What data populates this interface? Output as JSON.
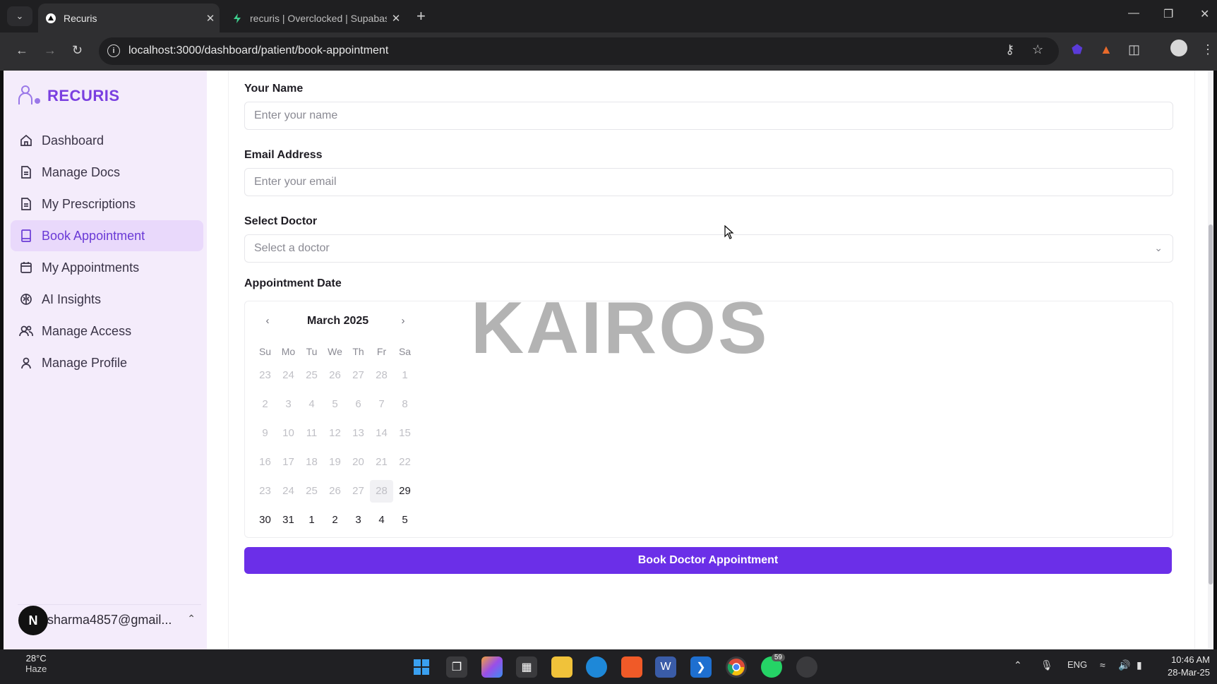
{
  "browser": {
    "tabs": [
      {
        "title": "Recuris",
        "active": true
      },
      {
        "title": "recuris | Overclocked | Supabas",
        "active": false
      }
    ],
    "url": "localhost:3000/dashboard/patient/book-appointment"
  },
  "sidebar": {
    "brand": "RECURIS",
    "items": [
      {
        "label": "Dashboard",
        "icon": "home-icon"
      },
      {
        "label": "Manage Docs",
        "icon": "document-icon"
      },
      {
        "label": "My Prescriptions",
        "icon": "document-icon"
      },
      {
        "label": "Book Appointment",
        "icon": "book-icon",
        "active": true
      },
      {
        "label": "My Appointments",
        "icon": "calendar-icon"
      },
      {
        "label": "AI Insights",
        "icon": "brain-icon"
      },
      {
        "label": "Manage Access",
        "icon": "users-icon"
      },
      {
        "label": "Manage Profile",
        "icon": "user-icon"
      }
    ],
    "user_email": "isharma4857@gmail...",
    "avatar_letter": "N"
  },
  "form": {
    "name_label": "Your Name",
    "name_placeholder": "Enter your name",
    "email_label": "Email Address",
    "email_placeholder": "Enter your email",
    "doctor_label": "Select Doctor",
    "doctor_placeholder": "Select a doctor",
    "date_label": "Appointment Date",
    "submit_label": "Book Doctor Appointment"
  },
  "calendar": {
    "month_label": "March 2025",
    "weekdays": [
      "Su",
      "Mo",
      "Tu",
      "We",
      "Th",
      "Fr",
      "Sa"
    ],
    "weeks": [
      [
        23,
        24,
        25,
        26,
        27,
        28,
        1
      ],
      [
        2,
        3,
        4,
        5,
        6,
        7,
        8
      ],
      [
        9,
        10,
        11,
        12,
        13,
        14,
        15
      ],
      [
        16,
        17,
        18,
        19,
        20,
        21,
        22
      ],
      [
        23,
        24,
        25,
        26,
        27,
        28,
        29
      ],
      [
        30,
        31,
        1,
        2,
        3,
        4,
        5
      ]
    ],
    "today": {
      "week": 4,
      "day": 5
    },
    "enabled_from": {
      "week": 4,
      "day": 6
    }
  },
  "watermark": "KAIROS",
  "taskbar": {
    "temperature": "28°C",
    "condition": "Haze",
    "language": "ENG",
    "time": "10:46 AM",
    "date": "28-Mar-25",
    "whatsapp_badge": "59"
  },
  "colors": {
    "brand": "#7a3fe0",
    "primary_button": "#6b2fe8",
    "sidebar_bg": "#f4ecfb",
    "active_item_bg": "#e9d9fb"
  }
}
